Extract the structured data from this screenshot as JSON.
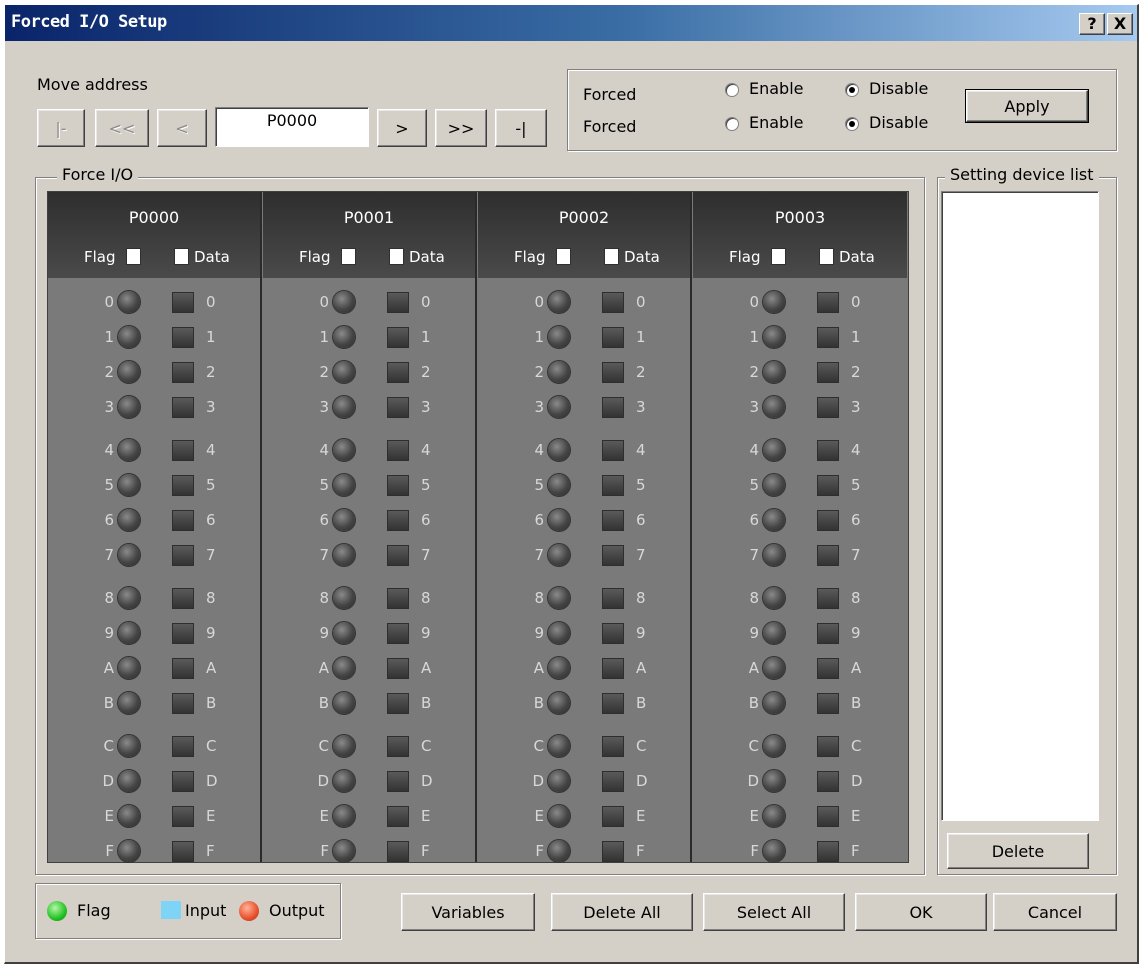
{
  "window": {
    "title": "Forced I/O Setup",
    "help_label": "?",
    "close_label": "X"
  },
  "move_address": {
    "label": "Move address",
    "first_label": "|-",
    "prev_page_label": "<<",
    "prev_label": "<",
    "address_value": "P0000",
    "next_label": ">",
    "next_page_label": ">>",
    "last_label": "-|"
  },
  "forced_panel": {
    "row1_label": "Forced",
    "row2_label": "Forced",
    "enable_label": "Enable",
    "disable_label": "Disable",
    "row1_selected": "Disable",
    "row2_selected": "Disable",
    "apply_label": "Apply"
  },
  "force_io": {
    "group_title": "Force I/O",
    "flag_label": "Flag",
    "data_label": "Data",
    "columns": [
      {
        "address": "P0000"
      },
      {
        "address": "P0001"
      },
      {
        "address": "P0002"
      },
      {
        "address": "P0003"
      }
    ],
    "bits": [
      "0",
      "1",
      "2",
      "3",
      "4",
      "5",
      "6",
      "7",
      "8",
      "9",
      "A",
      "B",
      "C",
      "D",
      "E",
      "F"
    ]
  },
  "device_list": {
    "title": "Setting device list",
    "delete_label": "Delete"
  },
  "legend": {
    "flag_label": "Flag",
    "input_label": "Input",
    "output_label": "Output",
    "flag_color": "#22c422",
    "input_color": "#7ed4f7",
    "output_color": "#e8502a"
  },
  "buttons": {
    "variables_label": "Variables",
    "delete_all_label": "Delete All",
    "select_all_label": "Select All",
    "ok_label": "OK",
    "cancel_label": "Cancel"
  }
}
